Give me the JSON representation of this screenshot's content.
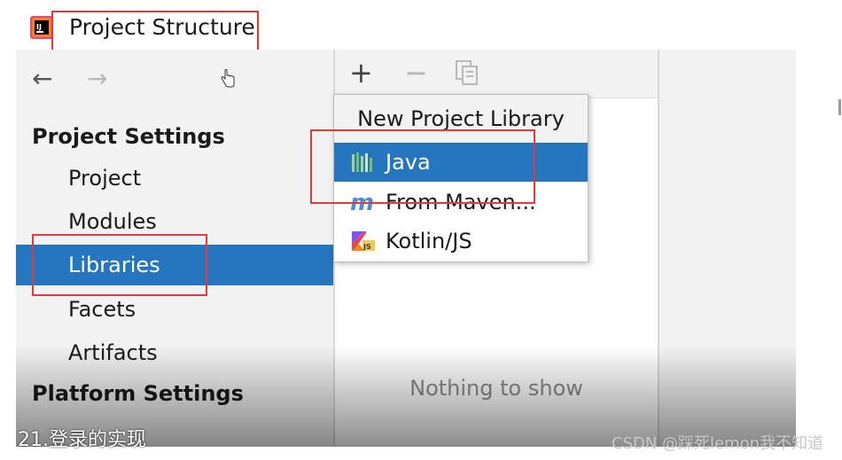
{
  "window": {
    "title": "Project Structure",
    "app_icon": "intellij-idea-icon"
  },
  "navigation": {
    "back_icon": "arrow-left-icon",
    "back_symbol": "←",
    "forward_icon": "arrow-right-icon",
    "forward_symbol": "→"
  },
  "sidebar": {
    "project_settings_heading": "Project Settings",
    "items": [
      {
        "label": "Project",
        "selected": false
      },
      {
        "label": "Modules",
        "selected": false
      },
      {
        "label": "Libraries",
        "selected": true
      },
      {
        "label": "Facets",
        "selected": false
      },
      {
        "label": "Artifacts",
        "selected": false
      }
    ],
    "platform_settings_heading": "Platform Settings"
  },
  "list_toolbar": {
    "add_symbol": "+",
    "remove_symbol": "−",
    "copy_icon": "copy-icon"
  },
  "list": {
    "empty_text": "Nothing to show"
  },
  "popup": {
    "header": "New Project Library",
    "items": [
      {
        "label": "Java",
        "icon": "java-library-icon",
        "selected": true
      },
      {
        "label": "From Maven...",
        "icon": "maven-icon",
        "selected": false
      },
      {
        "label": "Kotlin/JS",
        "icon": "kotlin-js-icon",
        "selected": false
      }
    ]
  },
  "overlay": {
    "caption": "21.登录的实现",
    "watermark": "CSDN @踩死lemon我不知道"
  },
  "colors": {
    "selection": "#2675bf",
    "highlight_box": "#e0393e",
    "panel_bg": "#f2f2f2"
  }
}
